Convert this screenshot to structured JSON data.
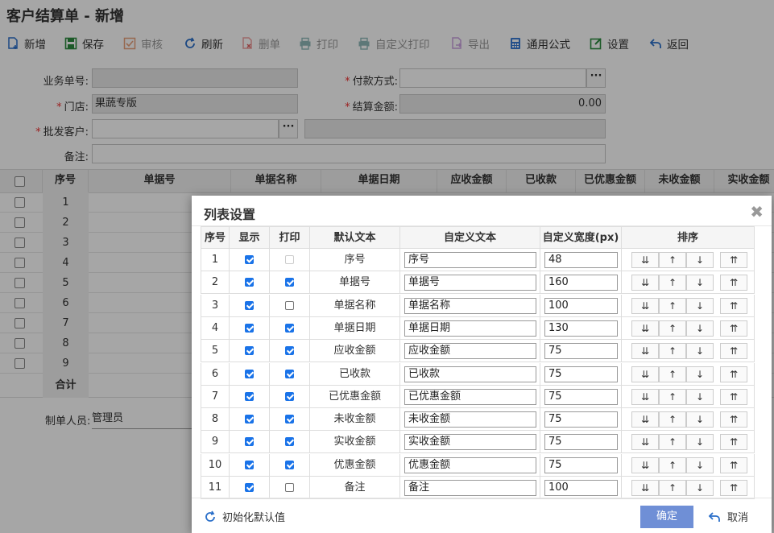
{
  "window": {
    "title": "客户结算单 - 新增"
  },
  "toolbar": {
    "add": "新增",
    "save": "保存",
    "audit": "审核",
    "refresh": "刷新",
    "delete": "删单",
    "print": "打印",
    "custom_print": "自定义打印",
    "export": "导出",
    "formula": "通用公式",
    "settings": "设置",
    "back": "返回"
  },
  "form": {
    "doc_no_label": "业务单号:",
    "store_label": "门店:",
    "store_value": "果蔬专版",
    "customer_label": "批发客户:",
    "remark_label": "备注:",
    "payment_label": "付款方式:",
    "amount_label": "结算金额:",
    "amount_value": "0.00"
  },
  "grid": {
    "headers": [
      "序号",
      "单据号",
      "单据名称",
      "单据日期",
      "应收金额",
      "已收款",
      "已优惠金额",
      "未收金额",
      "实收金额"
    ],
    "rows": [
      "1",
      "2",
      "3",
      "4",
      "5",
      "6",
      "7",
      "8",
      "9"
    ],
    "total_label": "合计",
    "creator_label": "制单人员:",
    "creator_value": "管理员"
  },
  "dialog": {
    "title": "列表设置",
    "headers": [
      "序号",
      "显示",
      "打印",
      "默认文本",
      "自定义文本",
      "自定义宽度(px)",
      "排序"
    ],
    "rows": [
      {
        "idx": "1",
        "show": true,
        "print": "disabled",
        "default": "序号",
        "custom": "序号",
        "width": "48"
      },
      {
        "idx": "2",
        "show": true,
        "print": "on",
        "default": "单据号",
        "custom": "单据号",
        "width": "160"
      },
      {
        "idx": "3",
        "show": true,
        "print": "off",
        "default": "单据名称",
        "custom": "单据名称",
        "width": "100"
      },
      {
        "idx": "4",
        "show": true,
        "print": "on",
        "default": "单据日期",
        "custom": "单据日期",
        "width": "130"
      },
      {
        "idx": "5",
        "show": true,
        "print": "on",
        "default": "应收金额",
        "custom": "应收金额",
        "width": "75"
      },
      {
        "idx": "6",
        "show": true,
        "print": "on",
        "default": "已收款",
        "custom": "已收款",
        "width": "75"
      },
      {
        "idx": "7",
        "show": true,
        "print": "on",
        "default": "已优惠金额",
        "custom": "已优惠金额",
        "width": "75"
      },
      {
        "idx": "8",
        "show": true,
        "print": "on",
        "default": "未收金额",
        "custom": "未收金额",
        "width": "75"
      },
      {
        "idx": "9",
        "show": true,
        "print": "on",
        "default": "实收金额",
        "custom": "实收金额",
        "width": "75"
      },
      {
        "idx": "10",
        "show": true,
        "print": "on",
        "default": "优惠金额",
        "custom": "优惠金额",
        "width": "75"
      },
      {
        "idx": "11",
        "show": true,
        "print": "off",
        "default": "备注",
        "custom": "备注",
        "width": "100"
      }
    ],
    "sort_buttons": [
      "⇊",
      "↑",
      "↓",
      "⇈"
    ],
    "reset_label": "初始化默认值",
    "ok_label": "确定",
    "cancel_label": "取消"
  },
  "colors": {
    "accent": "#1a73e8",
    "ok_button": "#6f8fd6",
    "required": "#e33333"
  }
}
